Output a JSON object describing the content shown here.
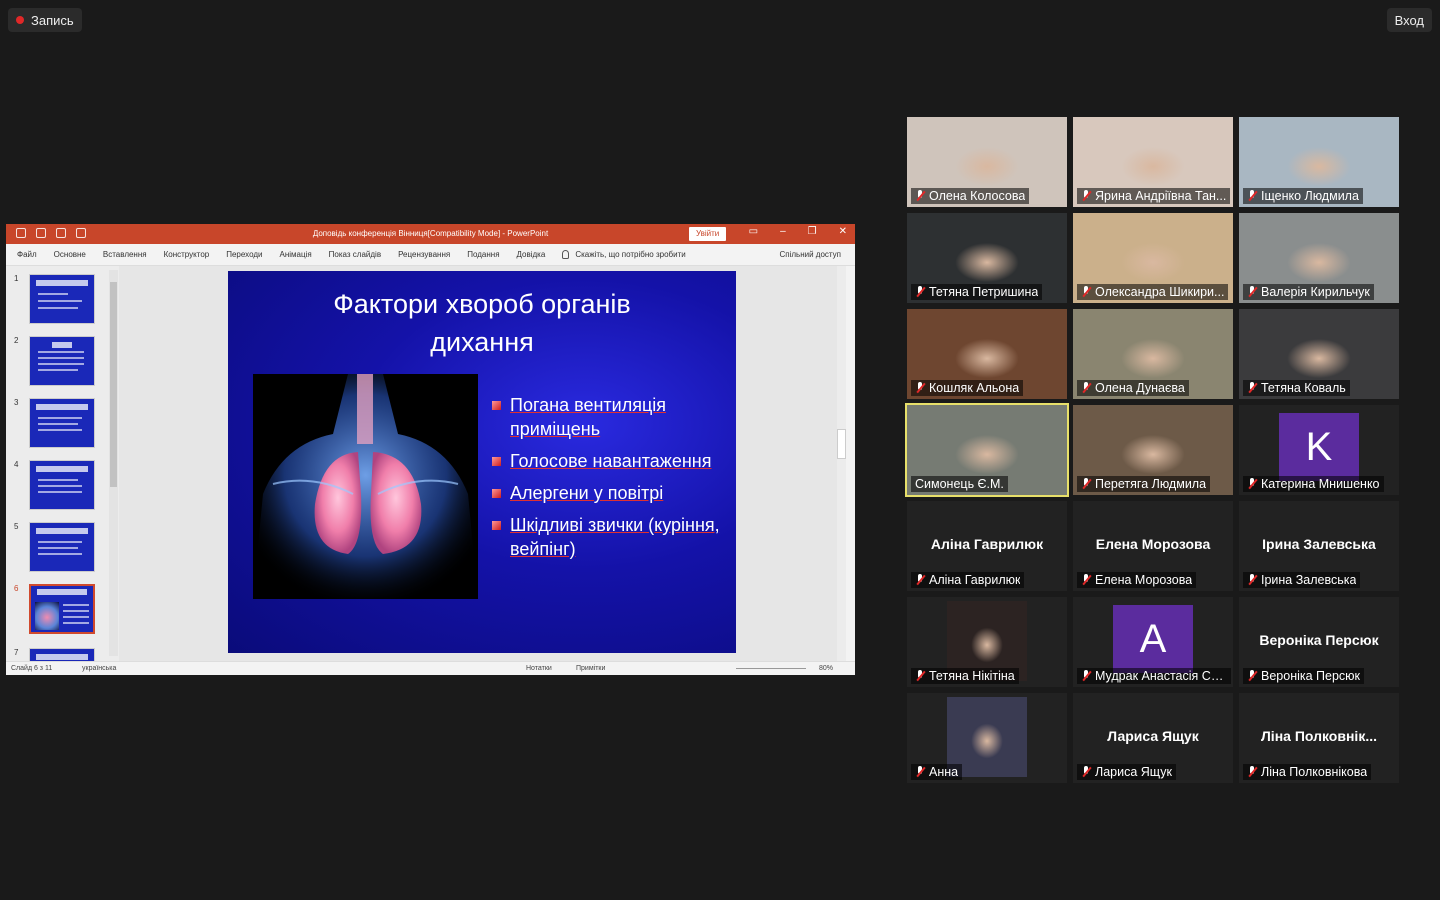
{
  "topbar": {
    "recording_label": "Запись",
    "view_label": "Вход"
  },
  "ppt": {
    "title": "Доповідь конференція Вінниця[Compatibility Mode]  -  PowerPoint",
    "signin_label": "Увійти",
    "menu": [
      "Файл",
      "Основне",
      "Вставлення",
      "Конструктор",
      "Переходи",
      "Анімація",
      "Показ слайдів",
      "Рецензування",
      "Подання",
      "Довідка"
    ],
    "tell_me": "Скажіть, що потрібно зробити",
    "share": "Спільний доступ",
    "thumbnails": [
      "1",
      "2",
      "3",
      "4",
      "5",
      "6",
      "7"
    ],
    "selected_slide": 6,
    "slide": {
      "title_line1": "Фактори хвороб органів",
      "title_line2": "дихання",
      "bullets": [
        "Погана вентиляція приміщень",
        "Голосове навантаження",
        "Алергени у повітрі",
        "Шкідливі звички (куріння, вейпінг)"
      ]
    },
    "status": {
      "slide_counter": "Слайд 6 з 11",
      "language": "українська",
      "notes": "Нотатки",
      "comments": "Примітки",
      "zoom": "80%"
    }
  },
  "gallery": [
    {
      "name": "Олена Колосова",
      "type": "video",
      "bg": "#cfc4bb"
    },
    {
      "name": "Ярина Андріївна Тан...",
      "type": "video",
      "bg": "#d8c8bd"
    },
    {
      "name": "Іщенко Людмила",
      "type": "video",
      "bg": "#a9b7c2"
    },
    {
      "name": "Тетяна Петришина",
      "type": "video",
      "bg": "#2d3032"
    },
    {
      "name": "Олександра Шикири...",
      "type": "video",
      "bg": "#cbb08b"
    },
    {
      "name": "Валерія Кирильчук",
      "type": "video",
      "bg": "#8a8e8e"
    },
    {
      "name": "Кошляк Альона",
      "type": "video",
      "bg": "#6e4630"
    },
    {
      "name": "Олена Дунаєва",
      "type": "video",
      "bg": "#8a8570"
    },
    {
      "name": "Тетяна Коваль",
      "type": "video",
      "bg": "#3b3b3d"
    },
    {
      "name": "Симонець Є.М.",
      "type": "video",
      "bg": "#767b73",
      "active": true,
      "unmuted": true
    },
    {
      "name": "Перетяга Людмила",
      "type": "video",
      "bg": "#6d5a48"
    },
    {
      "name": "Катерина Мнишенко",
      "type": "avatar",
      "letter": "K",
      "color": "#5b2c9e"
    },
    {
      "name": "Аліна Гаврилюк",
      "type": "name",
      "center": "Аліна Гаврилюк"
    },
    {
      "name": "Елена Морозова",
      "type": "name",
      "center": "Елена Морозова"
    },
    {
      "name": "Ірина Залевська",
      "type": "name",
      "center": "Ірина Залевська"
    },
    {
      "name": "Тетяна Нікітіна",
      "type": "video",
      "bg": "#2c2322",
      "narrow": true
    },
    {
      "name": "Мудрак Анастасія Се...",
      "type": "avatar",
      "letter": "A",
      "color": "#5b2c9e"
    },
    {
      "name": "Вероніка Персюк",
      "type": "name",
      "center": "Вероніка Персюк"
    },
    {
      "name": "Анна",
      "type": "video",
      "bg": "#3a3b52",
      "narrow": true
    },
    {
      "name": "Лариса Ящук",
      "type": "name",
      "center": "Лариса Ящук"
    },
    {
      "name": "Ліна Полковнікова",
      "type": "name",
      "center": "Ліна  Полковнік..."
    }
  ]
}
